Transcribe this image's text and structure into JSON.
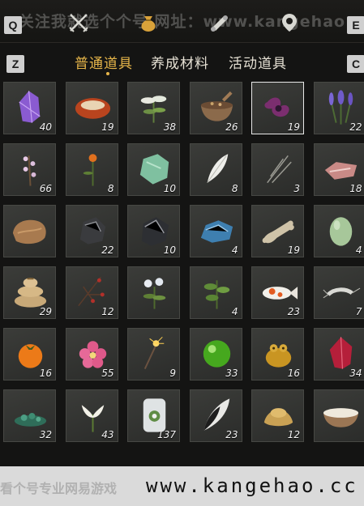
{
  "watermark_top": "关注我就选个个号 网址：www.kangehao",
  "watermark_bottom_cn": "看个号专业网易游戏",
  "watermark_bottom_url": "www.kangehao.cc",
  "keys": {
    "q": "Q",
    "e": "E",
    "z": "Z",
    "c": "C"
  },
  "tabs": [
    {
      "label": "普通道具",
      "active": true
    },
    {
      "label": "养成材料",
      "active": false
    },
    {
      "label": "活动道具",
      "active": false
    }
  ],
  "items": [
    {
      "icon": "purple-crystal-icon",
      "qty": "40"
    },
    {
      "icon": "red-agate-stone-icon",
      "qty": "19"
    },
    {
      "icon": "white-herb-icon",
      "qty": "38"
    },
    {
      "icon": "mortar-bowl-icon",
      "qty": "26"
    },
    {
      "icon": "purple-flower-icon",
      "qty": "19",
      "selected": true
    },
    {
      "icon": "lavender-plant-icon",
      "qty": "22"
    },
    {
      "icon": "small-blossom-twig-icon",
      "qty": "66"
    },
    {
      "icon": "orange-flower-icon",
      "qty": "8"
    },
    {
      "icon": "jade-stone-icon",
      "qty": "10"
    },
    {
      "icon": "white-feather-icon",
      "qty": "8"
    },
    {
      "icon": "gray-grass-icon",
      "qty": "3"
    },
    {
      "icon": "raw-meat-icon",
      "qty": "18"
    },
    {
      "icon": "fur-pelt-icon",
      "qty": ""
    },
    {
      "icon": "black-ore-icon",
      "qty": "22"
    },
    {
      "icon": "dark-ore-icon",
      "qty": "10"
    },
    {
      "icon": "blue-ore-icon",
      "qty": "4"
    },
    {
      "icon": "bone-icon",
      "qty": "19"
    },
    {
      "icon": "green-egg-icon",
      "qty": "4"
    },
    {
      "icon": "grain-sacks-icon",
      "qty": "29"
    },
    {
      "icon": "red-berry-branch-icon",
      "qty": "12"
    },
    {
      "icon": "white-flower-herb-icon",
      "qty": ""
    },
    {
      "icon": "green-herb-icon",
      "qty": "4"
    },
    {
      "icon": "koi-fish-icon",
      "qty": "23"
    },
    {
      "icon": "shrimp-icon",
      "qty": "7"
    },
    {
      "icon": "persimmon-icon",
      "qty": "16"
    },
    {
      "icon": "pink-flower-icon",
      "qty": "55"
    },
    {
      "icon": "sparkler-icon",
      "qty": "9"
    },
    {
      "icon": "green-orb-icon",
      "qty": "33"
    },
    {
      "icon": "gold-toad-icon",
      "qty": "16"
    },
    {
      "icon": "red-crystal-icon",
      "qty": "34"
    },
    {
      "icon": "green-pebbles-icon",
      "qty": "32"
    },
    {
      "icon": "white-lily-icon",
      "qty": "43"
    },
    {
      "icon": "flower-jar-icon",
      "qty": "137"
    },
    {
      "icon": "black-white-feather-icon",
      "qty": "23"
    },
    {
      "icon": "gold-ingot-icon",
      "qty": "12"
    },
    {
      "icon": "milk-bowl-icon",
      "qty": ""
    }
  ]
}
